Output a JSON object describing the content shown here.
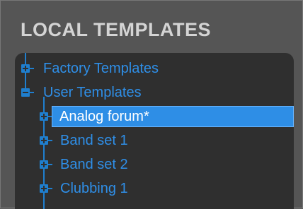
{
  "panel": {
    "title": "LOCAL TEMPLATES"
  },
  "tree": {
    "items": [
      {
        "label": "Factory Templates",
        "expanded": false,
        "level": 0
      },
      {
        "label": "User Templates",
        "expanded": true,
        "level": 0
      },
      {
        "label": "Analog forum*",
        "expanded": false,
        "level": 1,
        "selected": true
      },
      {
        "label": "Band set 1",
        "expanded": false,
        "level": 1
      },
      {
        "label": "Band set 2",
        "expanded": false,
        "level": 1
      },
      {
        "label": "Clubbing 1",
        "expanded": false,
        "level": 1
      }
    ]
  },
  "colors": {
    "accent": "#2f8fe8",
    "selection": "#2e8ee6",
    "tree_background": "#2f2f2f",
    "panel_background": "#555555"
  }
}
